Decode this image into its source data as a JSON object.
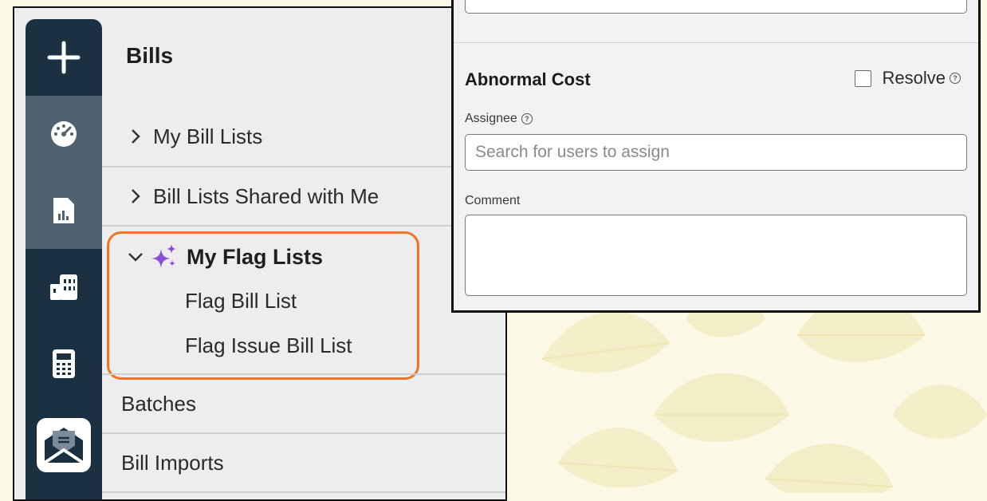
{
  "nav": {
    "title": "Bills",
    "items": [
      {
        "label": "My Bill Lists",
        "expanded": false
      },
      {
        "label": "Bill Lists Shared with Me",
        "expanded": false
      }
    ],
    "flag_group": {
      "label": "My Flag Lists",
      "icon": "sparkle-icon",
      "children": [
        "Flag Bill List",
        "Flag Issue Bill List"
      ]
    },
    "plain_items": [
      "Batches",
      "Bill Imports"
    ]
  },
  "rail": {
    "icons": [
      "plus-icon",
      "dashboard-gauge-icon",
      "report-chart-icon",
      "buildings-icon",
      "calculator-icon",
      "mail-envelope-icon"
    ]
  },
  "popup": {
    "section_title": "Abnormal Cost",
    "resolve_label": "Resolve",
    "assignee_label": "Assignee",
    "assignee_placeholder": "Search for users to assign",
    "comment_label": "Comment",
    "comment_value": ""
  },
  "colors": {
    "rail_bg": "#1b3040",
    "rail_active": "#50616f",
    "highlight": "#f07424",
    "sparkle": "#8a4fd6"
  }
}
